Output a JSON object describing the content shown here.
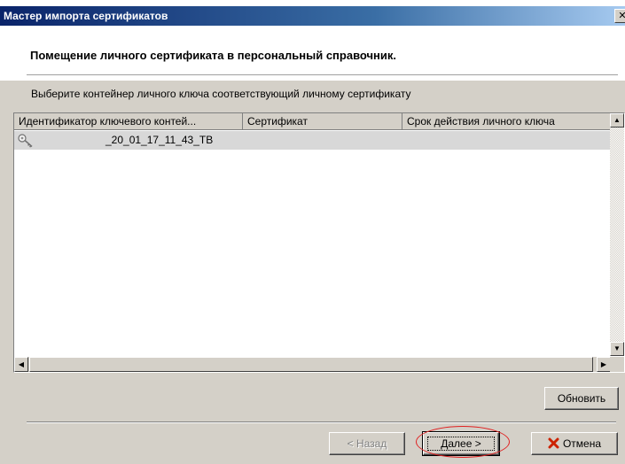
{
  "window": {
    "title": "Мастер импорта сертификатов"
  },
  "header": {
    "heading": "Помещение личного сертификата в персональный справочник."
  },
  "instruction": "Выберите контейнер личного ключа соответствующий личному сертификату",
  "table": {
    "columns": [
      "Идентификатор ключевого контей...",
      "Сертификат",
      "Срок действия личного ключа"
    ],
    "rows": [
      {
        "icon": "key-icon",
        "container": "_20_01_17_11_43_TB",
        "certificate": "",
        "validity": ""
      }
    ]
  },
  "buttons": {
    "refresh": "Обновить",
    "back": "< Назад",
    "next": "Далее >",
    "cancel": "Отмена"
  },
  "colors": {
    "titlebar": "#0a246a",
    "dialog": "#d4d0c8",
    "highlight_oval": "#e02020",
    "cancel_icon": "#cc2200"
  }
}
